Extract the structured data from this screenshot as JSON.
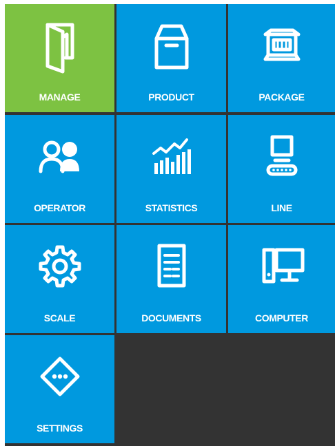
{
  "menu": {
    "tiles": [
      {
        "label": "MANAGE",
        "icon": "folder-icon",
        "active": true
      },
      {
        "label": "PRODUCT",
        "icon": "box-icon"
      },
      {
        "label": "PACKAGE",
        "icon": "package-icon"
      },
      {
        "label": "OPERATOR",
        "icon": "users-icon"
      },
      {
        "label": "STATISTICS",
        "icon": "statistics-icon"
      },
      {
        "label": "LINE",
        "icon": "conveyor-icon"
      },
      {
        "label": "SCALE",
        "icon": "gear-icon"
      },
      {
        "label": "DOCUMENTS",
        "icon": "document-icon"
      },
      {
        "label": "COMPUTER",
        "icon": "computer-icon"
      },
      {
        "label": "SETTINGS",
        "icon": "settings-icon"
      }
    ]
  },
  "colors": {
    "tile": "#0099df",
    "tile_active": "#7dc242",
    "background": "#333333",
    "text": "#ffffff"
  }
}
